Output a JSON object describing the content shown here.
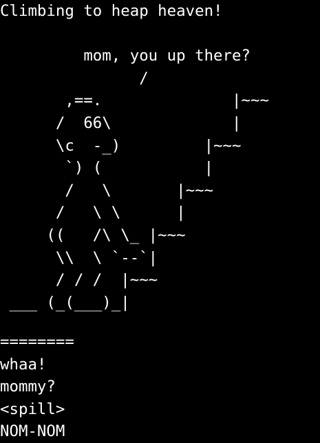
{
  "terminal": {
    "background": "#000000",
    "foreground": "#ffffff",
    "art_lines": [
      "Climbing to heap heaven!",
      "",
      "         mom, you up there?",
      "               /",
      "       ,==.              |~~~",
      "      /  66\\             |",
      "      \\c  -_)         |~~~",
      "       `) (           |",
      "       /   \\       |~~~",
      "      /   \\ \\      |",
      "     ((   /\\ \\_ |~~~",
      "      \\\\  \\ `--`|",
      "      / / /  |~~~",
      " ___ (_(___)_|"
    ],
    "output_lines": [
      "========",
      "whaa!",
      "mommy?",
      "<spill>",
      "NOM-NOM"
    ]
  }
}
